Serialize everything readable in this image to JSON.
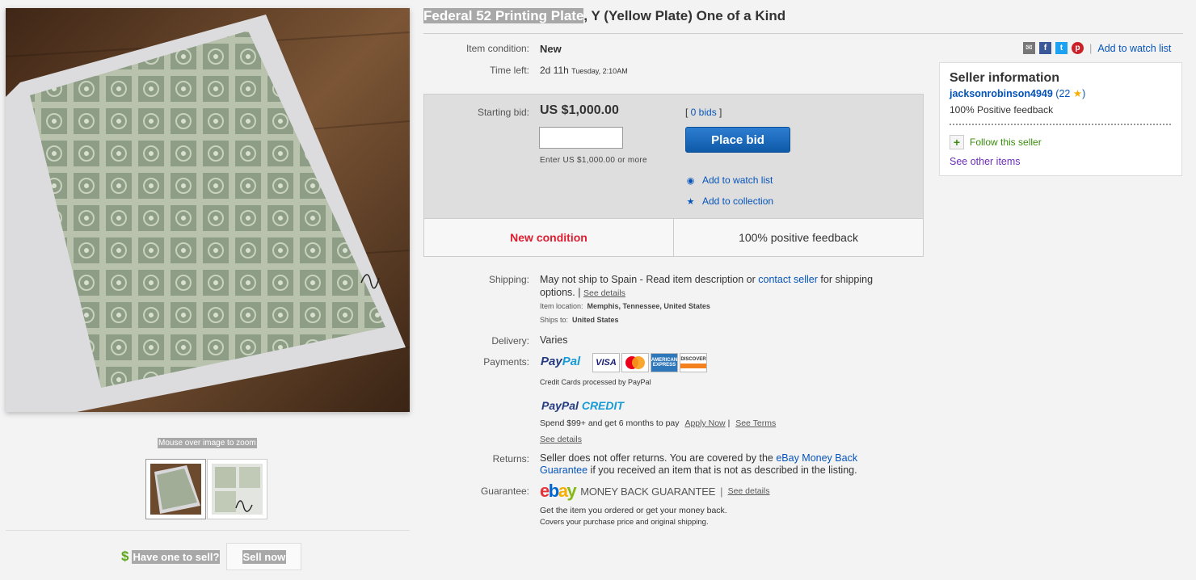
{
  "title": {
    "highlighted": "Federal 52 Printing Plate",
    "rest": ", Y (Yellow Plate) One of a Kind"
  },
  "gallery": {
    "zoom_hint": "Mouse over image to zoom"
  },
  "sell": {
    "prompt": "Have one to sell?",
    "button": "Sell now",
    "icon": "dollar-icon"
  },
  "condition": {
    "label": "Item condition:",
    "value": "New"
  },
  "time_left": {
    "label": "Time left:",
    "value": "2d 11h",
    "detail": "Tuesday, 2:10AM"
  },
  "bid": {
    "label": "Starting bid:",
    "price": "US $1,000.00",
    "input_value": "",
    "hint": "Enter US $1,000.00 or more",
    "bids_prefix": "[ ",
    "bids_count": "0 bids",
    "bids_suffix": " ]",
    "place_bid": "Place bid",
    "watch": "Add to watch list",
    "collection": "Add to collection",
    "badge_left": "New condition",
    "badge_right": "100% positive feedback"
  },
  "shipping": {
    "label": "Shipping:",
    "text_before": "May not ship to Spain - Read item description or ",
    "contact_link": "contact seller",
    "text_after": " for shipping options. | ",
    "see_details": "See details",
    "location_label": "Item location:",
    "location": "Memphis, Tennessee, United States",
    "ships_to_label": "Ships to:",
    "ships_to": "United States"
  },
  "delivery": {
    "label": "Delivery:",
    "value": "Varies"
  },
  "payments": {
    "label": "Payments:",
    "paypal_a": "Pay",
    "paypal_b": "Pal",
    "cards": {
      "visa": "VISA",
      "mc": "MasterCard",
      "amex": "AMERICAN EXPRESS",
      "disc": "DISCOVER"
    },
    "cc_text": "Credit Cards processed by PayPal",
    "credit_a": "PayPal ",
    "credit_b": "CREDIT",
    "spend": "Spend $99+ and get 6 months to pay",
    "apply_now": "Apply Now",
    "sep": "|",
    "see_terms": "See Terms",
    "see_details": "See details"
  },
  "returns": {
    "label": "Returns:",
    "before": "Seller does not offer returns. You are covered by the ",
    "link": "eBay Money Back Guarantee",
    "after": " if you received an item that is not as described in the listing."
  },
  "guarantee": {
    "label": "Guarantee:",
    "logo_e": "e",
    "logo_b": "b",
    "logo_a": "a",
    "logo_y": "y",
    "mbg": "MONEY BACK GUARANTEE",
    "sep": "|",
    "see_details": "See details",
    "line1": "Get the item you ordered or get your money back.",
    "line2": "Covers your purchase price and original shipping."
  },
  "share": {
    "sep": "|",
    "watch": "Add to watch list"
  },
  "seller": {
    "title": "Seller information",
    "name": "jacksonrobinson4949",
    "score_open": " (",
    "score": "22",
    "score_close": ")",
    "feedback": "100% Positive feedback",
    "follow": "Follow this seller",
    "other_items": "See other items"
  },
  "colors": {
    "accent": "#0654ba",
    "bid_button": "#1a66bf",
    "condition_red": "#dd1e31",
    "follow_green": "#3a8d0f",
    "visited_purple": "#6c2eb9"
  }
}
